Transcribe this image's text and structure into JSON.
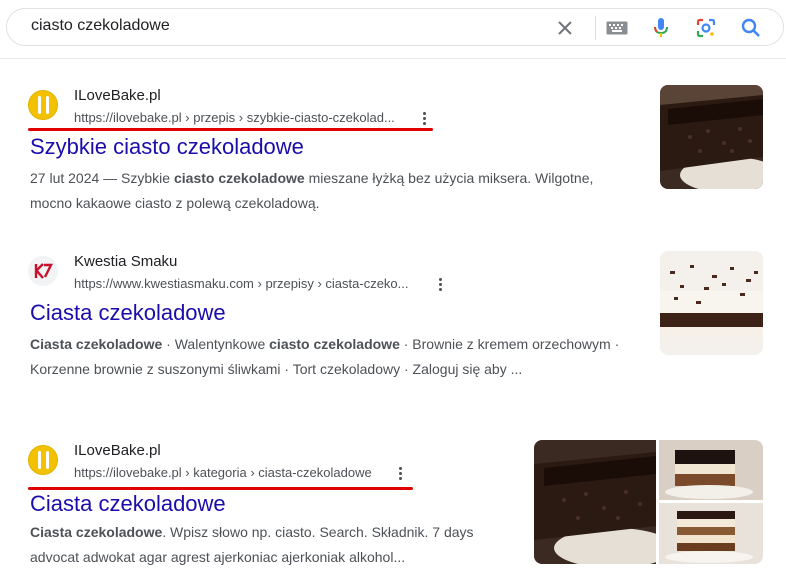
{
  "search": {
    "query": "ciasto czekoladowe",
    "icons": [
      "close-icon",
      "keyboard-icon",
      "microphone-icon",
      "lens-icon",
      "search-icon"
    ]
  },
  "results": [
    {
      "site_name": "ILoveBake.pl",
      "url": "https://ilovebake.pl › przepis › szybkie-ciasto-czekolad...",
      "title": "Szybkie ciasto czekoladowe",
      "snippet_parts": [
        "27 lut 2024 — Szybkie ",
        "ciasto czekoladowe",
        " mieszane łyżką bez użycia miksera. Wilgotne, mocno kakaowe ciasto z polewą czekoladową."
      ]
    },
    {
      "site_name": "Kwestia Smaku",
      "url": "https://www.kwestiasmaku.com › przepisy › ciasta-czeko...",
      "title": "Ciasta czekoladowe",
      "snippet_parts": [
        "Ciasta czekoladowe",
        " · Walentynkowe ",
        "ciasto czekoladowe",
        " · Brownie z kremem orzechowym · Korzenne brownie z suszonymi śliwkami · Tort czekoladowy · Zaloguj się aby ..."
      ]
    },
    {
      "site_name": "ILoveBake.pl",
      "url": "https://ilovebake.pl › kategoria › ciasta-czekoladowe",
      "title": "Ciasta czekoladowe",
      "snippet_parts": [
        "Ciasta czekoladowe",
        ". Wpisz słowo np. ciasto. Search. Składnik. 7 days advocat adwokat agar agrest ajerkoniac ajerkoniak alkohol..."
      ]
    }
  ],
  "colors": {
    "link": "#1a0dab",
    "highlight_underline": "#e00000",
    "favicon_ilovebake": "#f2c100"
  }
}
